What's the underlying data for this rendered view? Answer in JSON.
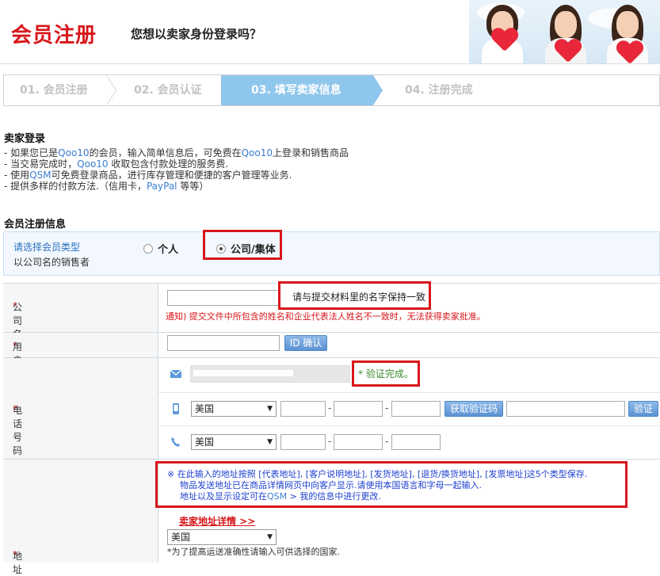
{
  "header": {
    "title": "会员注册",
    "subtitle": "您想以卖家身份登录吗？"
  },
  "steps": [
    {
      "label": "01. 会员注册",
      "active": false
    },
    {
      "label": "02. 会员认证",
      "active": false
    },
    {
      "label": "03. 填写卖家信息",
      "active": true
    },
    {
      "label": "04. 注册完成",
      "active": false
    }
  ],
  "seller_login": {
    "title": "卖家登录",
    "lines": [
      {
        "pre": "- 如果您已是",
        "hl": "Qoo10",
        "post": "的会员，输入简单信息后，可免费在",
        "hl2": "Qoo10",
        "post2": "上登录和销售商品"
      },
      {
        "pre": "- 当交易完成时，",
        "hl": "Qoo10",
        "post": " 收取包含付款处理的服务费.",
        "hl2": "",
        "post2": ""
      },
      {
        "pre": "- 使用",
        "hl": "QSM",
        "post": "可免费登录商品，进行库存管理和便捷的客户管理等业务.",
        "hl2": "",
        "post2": ""
      },
      {
        "pre": "- 提供多样的付款方法.（信用卡，",
        "hl": "PayPal",
        "post": " 等等）",
        "hl2": "",
        "post2": ""
      }
    ]
  },
  "member_info": {
    "title": "会员注册信息",
    "type_label": "请选择会员类型",
    "type_sub": "以公司名的销售者",
    "option_personal": "个人",
    "option_company": "公司/集体",
    "selected": "company"
  },
  "form": {
    "company_name": {
      "label": "公司名",
      "hint": "请与提交材料里的名字保持一致",
      "notice": "通知) 提交文件中所包含的姓名和企业代表法人姓名不一致时，无法获得卖家批准。"
    },
    "username": {
      "label": "用户名登录",
      "button": "ID 确认"
    },
    "phone": {
      "label": "电话号码",
      "verified": "* 验证完成。",
      "country1": "美国",
      "country2": "美国",
      "get_code_button": "获取验证码",
      "verify_button": "验证"
    },
    "address": {
      "label": "地址",
      "note_line1": "※ 在此输入的地址按照 [代表地址], [客户说明地址], [发货地址], [退货/换货地址], [发票地址]这5个类型保存.",
      "note_line2": "物品发送地址已在商品详情网页中向客户显示.请使用本国语言和字母一起输入.",
      "note_line3_pre": "地址以及显示设定可在",
      "note_line3_hl": "QSM",
      "note_line3_post": " > 我的信息中进行更改.",
      "detail_link": "卖家地址详情 >>",
      "country": "美国",
      "country_hint": "*为了提高运送准确性请输入可供选择的国家."
    }
  },
  "colors": {
    "brand_red": "#d8161b",
    "step_active": "#8fc6ec",
    "link_blue": "#3a7fd0"
  }
}
